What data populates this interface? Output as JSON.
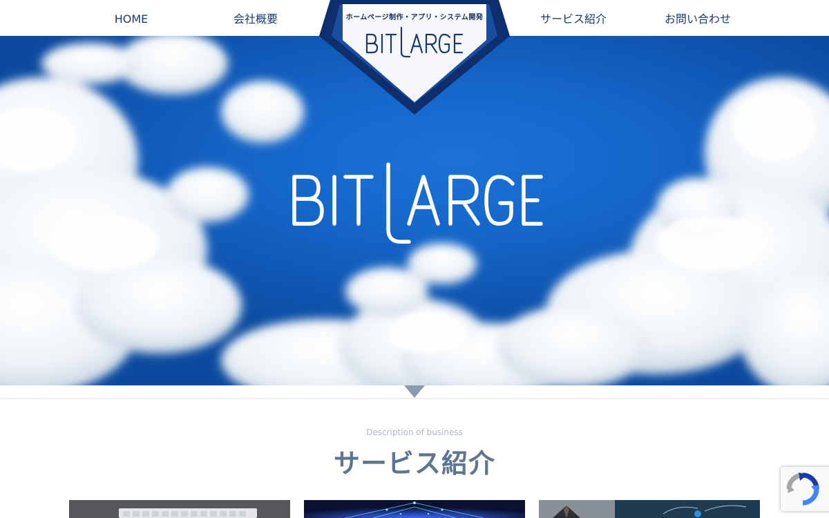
{
  "nav": {
    "home": "HOME",
    "company": "会社概要",
    "service": "サービス紹介",
    "contact": "お問い合わせ"
  },
  "logo": {
    "tagline": "ホームページ制作・アプリ・システム開発",
    "wordmark": "BITLARGE",
    "icon": "bitlarge-logo-icon"
  },
  "hero": {
    "wordmark": "BITLARGE"
  },
  "section": {
    "subtitle": "Description of business",
    "title": "サービス紹介"
  },
  "cards": [
    {
      "image": "keyboard-photo"
    },
    {
      "image": "technology-network-photo"
    },
    {
      "image": "business-growth-photo"
    }
  ],
  "recaptcha": {
    "icon": "recaptcha-icon"
  },
  "colors": {
    "navy": "#1b3a6b",
    "badge_dark": "#0e2f6e",
    "badge_mid": "#1a4fa0",
    "sky": "#1566c9",
    "section_title": "#5e7590",
    "section_subtitle": "#aeb9c8"
  }
}
